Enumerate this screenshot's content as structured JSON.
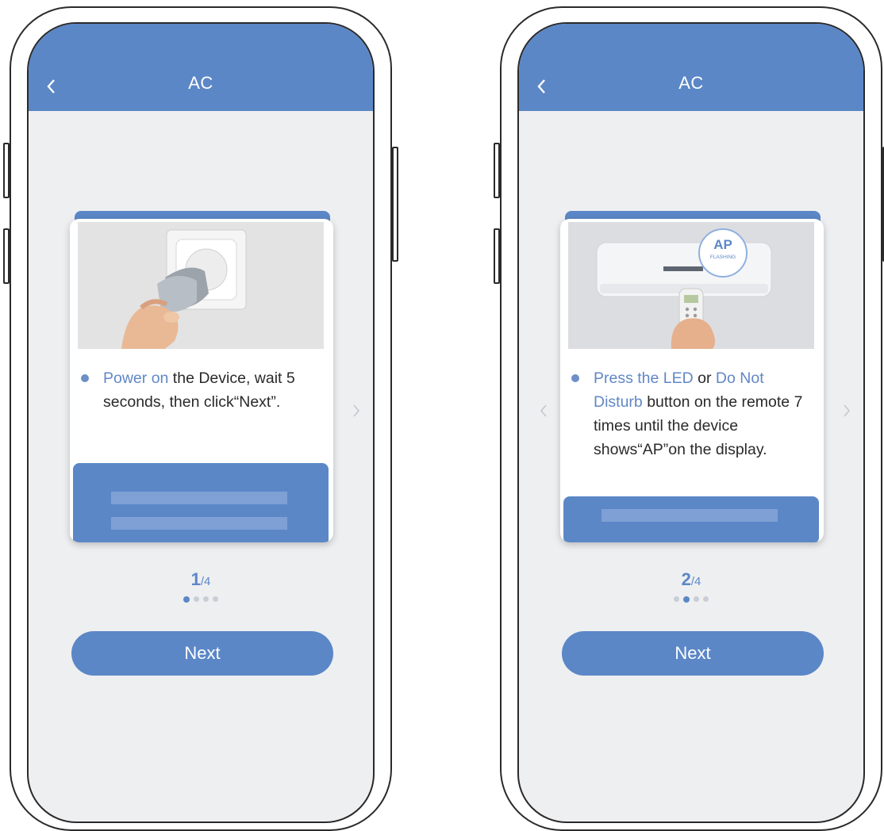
{
  "screens": [
    {
      "title": "AC",
      "pager": {
        "current": "1",
        "total": "/4"
      },
      "dots": 4,
      "active_dot": 0,
      "instruction": {
        "part1_hl": "Power on",
        "part2": " the Device, wait 5 seconds, then click“Next”."
      },
      "next_label": "Next",
      "has_prev_arrow": false,
      "has_next_arrow": true
    },
    {
      "title": "AC",
      "pager": {
        "current": "2",
        "total": "/4"
      },
      "dots": 4,
      "active_dot": 1,
      "instruction": {
        "part1_hl": "Press the LED",
        "part2": " or ",
        "part3_hl": "Do Not Disturb",
        "part4": " button on the remote 7 times until the device shows“AP”on the display."
      },
      "badge": {
        "main": "AP",
        "sub": "FLASHING"
      },
      "next_label": "Next",
      "has_prev_arrow": true,
      "has_next_arrow": true
    }
  ],
  "colors": {
    "accent": "#5b87c7",
    "screen_bg": "#eeeff1",
    "highlight_text": "#6187c7"
  },
  "icons": [
    "back-chevron-icon",
    "chevron-left-icon",
    "chevron-right-icon"
  ]
}
